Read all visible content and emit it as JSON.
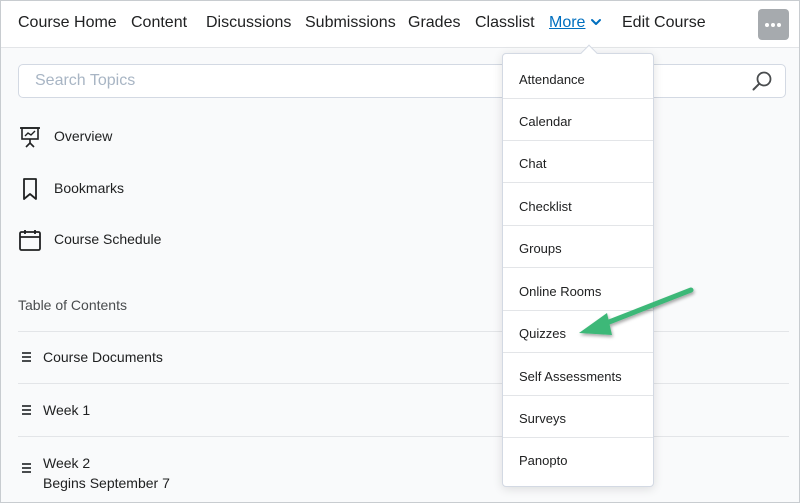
{
  "navbar": {
    "items": [
      "Course Home",
      "Content",
      "Discussions",
      "Submissions",
      "Grades",
      "Classlist",
      "More",
      "Edit Course"
    ],
    "active": "More",
    "more_menu_icon": "chevron-down-icon",
    "overflow_icon": "ellipsis-icon"
  },
  "search": {
    "placeholder": "Search Topics",
    "icon": "search-icon"
  },
  "sidebar": {
    "links": [
      {
        "label": "Overview",
        "icon": "presentation-board-icon"
      },
      {
        "label": "Bookmarks",
        "icon": "bookmark-icon"
      },
      {
        "label": "Course Schedule",
        "icon": "calendar-icon"
      }
    ]
  },
  "toc": {
    "heading": "Table of Contents",
    "modules": [
      {
        "title": "Course Documents",
        "subtitle": ""
      },
      {
        "title": "Week 1",
        "subtitle": ""
      },
      {
        "title": "Week 2",
        "subtitle": "Begins September 7"
      }
    ]
  },
  "more_menu": {
    "items": [
      "Attendance",
      "Calendar",
      "Chat",
      "Checklist",
      "Groups",
      "Online Rooms",
      "Quizzes",
      "Self Assessments",
      "Surveys",
      "Panopto"
    ],
    "highlighted": "Quizzes"
  },
  "colors": {
    "link_active": "#006fbf",
    "annotation_arrow": "#3cb878",
    "overflow_button": "#a6aaae"
  }
}
